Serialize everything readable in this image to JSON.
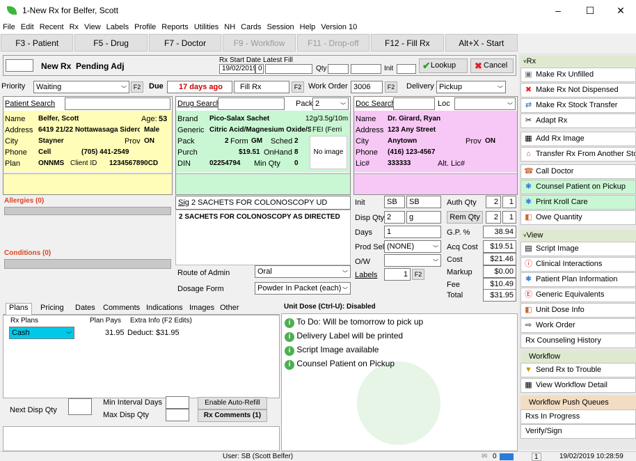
{
  "window": {
    "title": "1-New Rx for Belfer, Scott",
    "min": "–",
    "max": "☐",
    "close": "✕"
  },
  "menu": [
    "File",
    "Edit",
    "Recent",
    "Rx",
    "View",
    "Labels",
    "Profile",
    "Reports",
    "Utilities",
    "NH",
    "Cards",
    "Session",
    "Help",
    "Version 10"
  ],
  "fkeys": [
    {
      "label": "F3 - Patient",
      "disabled": false
    },
    {
      "label": "F5 - Drug",
      "disabled": false
    },
    {
      "label": "F7 - Doctor",
      "disabled": false
    },
    {
      "label": "F9 - Workflow",
      "disabled": true
    },
    {
      "label": "F11 - Drop-off",
      "disabled": true
    },
    {
      "label": "F12 - Fill Rx",
      "disabled": false
    },
    {
      "label": "Alt+X - Start",
      "disabled": false
    }
  ],
  "header": {
    "new_rx": "New Rx",
    "pending": "Pending Adj",
    "start_date_label": "Rx Start Date",
    "latest_fill_label": "Latest Fill",
    "start_date": "19/02/2019",
    "latest_fill": "0",
    "qty_label": "Qty",
    "init_label": "Init",
    "lookup": "Lookup",
    "cancel": "Cancel"
  },
  "row2": {
    "priority_label": "Priority",
    "priority": "Waiting",
    "f2": "F2",
    "due_label": "Due",
    "due": "17 days ago",
    "fill_rx": "Fill Rx",
    "work_order_label": "Work Order",
    "work_order": "3006",
    "delivery_label": "Delivery",
    "delivery": "Pickup"
  },
  "patient": {
    "search_label": "Patient Search",
    "name_label": "Name",
    "name": "Belfer, Scott",
    "age_label": "Age:",
    "age": "53",
    "address_label": "Address",
    "address": "6419 21/22 Nottawasaga Sidero",
    "sex": "Male",
    "city_label": "City",
    "city": "Stayner",
    "prov_label": "Prov",
    "prov": "ON",
    "phone_label": "Phone",
    "phone_type": "Cell",
    "phone": "(705) 441-2549",
    "plan_label": "Plan",
    "plan": "ONNMS",
    "client_label": "Client ID",
    "client": "1234567890CD",
    "allergies": "Allergies (0)",
    "conditions": "Conditions (0)"
  },
  "drug": {
    "search_label": "Drug Search",
    "pack_label": "Pack",
    "pack": "2",
    "brand_label": "Brand",
    "brand": "Pico-Salax Sachet",
    "strength": "12g/3.5g/10m",
    "generic_label": "Generic",
    "generic": "Citric Acid/Magnesium Oxide/So",
    "fei": "FEI (Ferri",
    "pack2_label": "Pack",
    "pack2": "2",
    "form_label": "Form",
    "form": "GM",
    "sched_label": "Sched",
    "sched": "2",
    "purch_label": "Purch",
    "purch": "$19.51",
    "onhand_label": "OnHand",
    "onhand": "8",
    "din_label": "DIN",
    "din": "02254794",
    "minqty_label": "Min Qty",
    "minqty": "0",
    "no_image": "No image"
  },
  "doctor": {
    "search_label": "Doc Search",
    "loc_label": "Loc",
    "name_label": "Name",
    "name": "Dr. Girard, Ryan",
    "address_label": "Address",
    "address": "123 Any Street",
    "city_label": "City",
    "city": "Anytown",
    "prov_label": "Prov",
    "prov": "ON",
    "phone_label": "Phone",
    "phone": "(416) 123-4567",
    "lic_label": "Lic#",
    "lic": "333333",
    "alt_lic_label": "Alt. Lic#"
  },
  "sig": {
    "label": "Sig",
    "value": "2 SACHETS FOR COLONOSCOPY UD",
    "expanded": "2 SACHETS FOR COLONOSCOPY AS DIRECTED",
    "route_label": "Route of Admin",
    "route": "Oral",
    "dosage_label": "Dosage Form",
    "dosage": "Powder In Packet (each)"
  },
  "qty": {
    "init_label": "Init",
    "init1": "SB",
    "init2": "SB",
    "auth_label": "Auth Qty",
    "auth1": "2",
    "auth2": "1",
    "disp_label": "Disp Qty",
    "disp": "2",
    "unit": "g",
    "rem_label": "Rem Qty",
    "rem1": "2",
    "rem2": "1",
    "days_label": "Days",
    "days": "1",
    "gp_label": "G.P. %",
    "gp": "38.94",
    "prodsel_label": "Prod Sel",
    "prodsel": "(NONE)",
    "acq_label": "Acq Cost",
    "acq": "$19.51",
    "ow_label": "O/W",
    "cost_label": "Cost",
    "cost": "$21.46",
    "markup_label": "Markup",
    "markup": "$0.00",
    "labels_label": "Labels",
    "labels": "1",
    "f2": "F2",
    "fee_label": "Fee",
    "fee": "$10.49",
    "total_label": "Total",
    "total": "$31.95"
  },
  "tabs": [
    "Plans",
    "Pricing",
    "Dates",
    "Comments",
    "Indications",
    "Images",
    "Other"
  ],
  "plans": {
    "col1": "Rx Plans",
    "col2": "Plan Pays",
    "col3": "Extra Info (F2 Edits)",
    "plan": "Cash",
    "pays": "31.95",
    "deduct": "Deduct: $31.95",
    "next_disp_label": "Next Disp Qty",
    "min_interval_label": "Min Interval Days",
    "max_disp_label": "Max Disp Qty",
    "auto_refill": "Enable Auto-Refill",
    "rx_comments": "Rx Comments (1)"
  },
  "unit_dose": "Unit Dose (Ctrl-U): Disabled",
  "notes": [
    "To Do: Will be tomorrow to pick up",
    "Delivery Label will be printed",
    "Script Image available",
    "Counsel Patient on Pickup"
  ],
  "rx_panel": {
    "header": "Rx",
    "items": [
      {
        "label": "Make Rx Unfilled",
        "icon": "unfilled-icon"
      },
      {
        "label": "Make Rx Not Dispensed",
        "icon": "not-dispensed-icon"
      },
      {
        "label": "Make Rx Stock Transfer",
        "icon": "transfer-icon"
      },
      {
        "label": "Adapt Rx",
        "icon": "adapt-icon"
      },
      {
        "label": "Add Rx Image",
        "icon": "image-icon"
      },
      {
        "label": "Transfer Rx From Another Store",
        "icon": "store-icon"
      },
      {
        "label": "Call Doctor",
        "icon": "doctor-icon"
      },
      {
        "label": "Counsel Patient on Pickup",
        "icon": "counsel-icon"
      },
      {
        "label": "Print Kroll Care",
        "icon": "print-icon"
      },
      {
        "label": "Owe Quantity",
        "icon": "owe-icon"
      }
    ]
  },
  "view_panel": {
    "header": "View",
    "items": [
      {
        "label": "Script Image",
        "icon": "script-icon"
      },
      {
        "label": "Clinical Interactions",
        "icon": "warning-icon"
      },
      {
        "label": "Patient Plan Information",
        "icon": "plan-icon"
      },
      {
        "label": "Generic Equivalents",
        "icon": "generic-icon"
      },
      {
        "label": "Unit Dose Info",
        "icon": "unitdose-icon"
      },
      {
        "label": "Work Order",
        "icon": "workorder-icon"
      },
      {
        "label": "Rx Counseling History",
        "icon": ""
      }
    ]
  },
  "workflow": {
    "header": "Workflow",
    "items": [
      "Send Rx to Trouble",
      "View Workflow Detail"
    ],
    "queues_header": "Workflow Push Queues",
    "queues": [
      "Rxs In Progress",
      "Verify/Sign"
    ]
  },
  "status": {
    "user": "User: SB (Scott Belfer)",
    "count": "0",
    "page": "1",
    "datetime": "19/02/2019  10:28:59"
  }
}
